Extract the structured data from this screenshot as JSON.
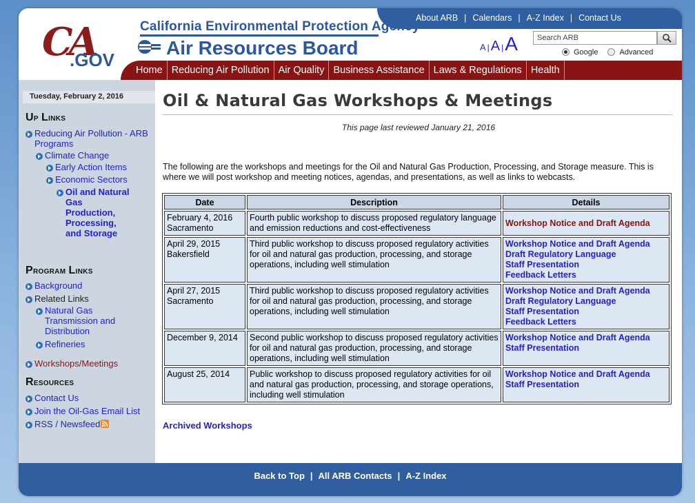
{
  "logo": {
    "ca": "CA",
    "gov": ".GOV"
  },
  "header": {
    "agency": "California Environmental Protection Agency",
    "board": "Air Resources Board",
    "top_links": [
      "About ARB",
      "Calendars",
      "A-Z Index",
      "Contact Us"
    ],
    "top_sep": "|",
    "font_sizes": [
      "A",
      "A",
      "A"
    ],
    "font_sep": "|",
    "search": {
      "placeholder": "Search ARB",
      "options": [
        "Google",
        "Advanced"
      ],
      "selected": "Google"
    }
  },
  "nav": [
    "Home",
    "Reducing Air Pollution",
    "Air Quality",
    "Business Assistance",
    "Laws & Regulations",
    "Health"
  ],
  "sidebar": {
    "date": "Tuesday, February 2, 2016",
    "up_links_heading": {
      "first": "U",
      "rest": "p ",
      "first2": "L",
      "rest2": "inks"
    },
    "up_links": [
      "Reducing Air Pollution - ARB Programs",
      "Climate Change",
      "Early Action Items",
      "Economic Sectors",
      "Oil and Natural Gas Production, Processing, and Storage"
    ],
    "program_links_heading": {
      "first": "P",
      "rest": "rogram ",
      "first2": "L",
      "rest2": "inks"
    },
    "program_links": [
      "Background",
      "Related Links",
      "Natural Gas Transmission and Distribution",
      "Refineries",
      "Workshops/Meetings"
    ],
    "resources_heading": {
      "first": "R",
      "rest": "esources"
    },
    "resources": [
      "Contact Us",
      "Join the Oil-Gas Email List",
      "RSS / Newsfeed"
    ],
    "colors": {
      "bg": "#ccd5e0",
      "link": "#2222cc",
      "current": "#8a1414"
    }
  },
  "main": {
    "title": "Oil & Natural Gas Workshops & Meetings",
    "reviewed": "This page last reviewed January 21, 2016",
    "intro": "The following are the workshops and meetings for the Oil and Natural Gas Production, Processing, and Storage measure. This is where we will post workshop and meeting notices, agendas, and presentations, as well as links to webcasts.",
    "table": {
      "headers": [
        "Date",
        "Description",
        "Details"
      ],
      "rows": [
        {
          "date": "February 4, 2016",
          "place": "Sacramento",
          "description": "Fourth public workshop to discuss proposed regulatory language and emission reductions and cost-effectiveness",
          "details": [
            "Workshop Notice and Draft Agenda"
          ]
        },
        {
          "date": "April 29, 2015",
          "place": "Bakersfield",
          "description": "Third public workshop to discuss proposed regulatory activities for oil and natural gas production, processing, and storage operations, including well stimulation",
          "details": [
            "Workshop Notice and Draft Agenda",
            "Draft Regulatory Language",
            "Staff Presentation",
            "Feedback Letters"
          ]
        },
        {
          "date": "April 27, 2015",
          "place": "Sacramento",
          "description": "Third public workshop to discuss proposed regulatory activities for oil and natural gas production, processing, and storage operations, including well stimulation",
          "details": [
            "Workshop Notice and Draft Agenda",
            "Draft Regulatory Language",
            "Staff Presentation",
            "Feedback Letters"
          ]
        },
        {
          "date": "December 9, 2014",
          "place": "",
          "description": "Second public workshop to discuss proposed regulatory activities for oil and natural gas production, processing, and storage operations, including well stimulation",
          "details": [
            "Workshop Notice and Draft Agenda",
            "Staff Presentation"
          ]
        },
        {
          "date": "August 25, 2014",
          "place": "",
          "description": "Public workshop to discuss proposed regulatory activities for oil and natural gas production, processing, and storage operations, including well stimulation",
          "details": [
            "Workshop Notice and Draft Agenda",
            "Staff Presentation"
          ]
        }
      ]
    },
    "archived": "Archived Workshops"
  },
  "footer": {
    "links": [
      "Back to Top",
      "All ARB Contacts",
      "A-Z Index"
    ],
    "sep": "|"
  },
  "colors": {
    "brand_blue": "#2f5fa0",
    "nav_red": "#8a1414",
    "table_cell": "#dde6f3"
  }
}
